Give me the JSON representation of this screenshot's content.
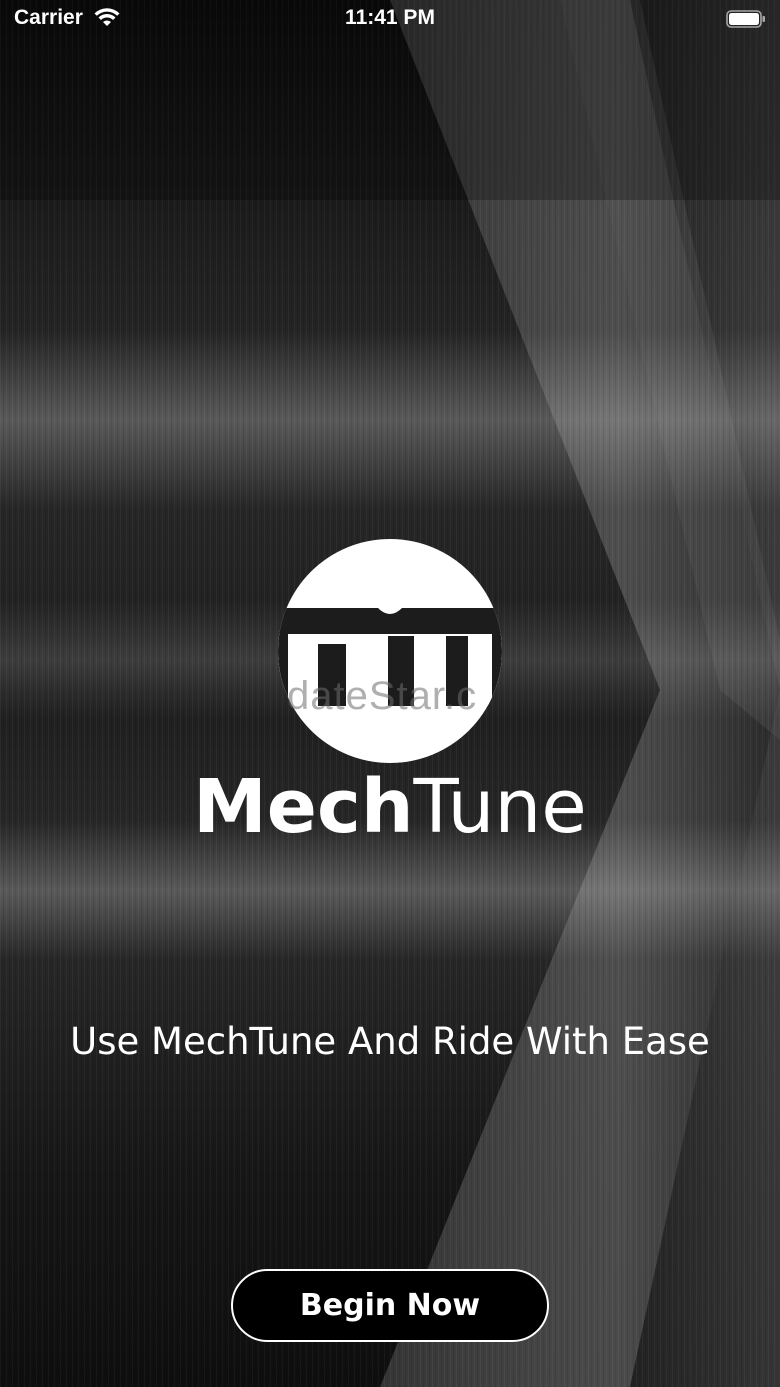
{
  "status_bar": {
    "carrier": "Carrier",
    "time": "11:41 PM",
    "icons": [
      "wifi-icon",
      "battery-icon"
    ]
  },
  "logo": {
    "icon": "mechtune-logo-icon",
    "watermark_text": "dateStar.c"
  },
  "brand": {
    "name_bold": "Mech",
    "name_light": "Tune"
  },
  "tagline": "Use MechTune And Ride With Ease",
  "begin_button": {
    "label": "Begin Now"
  },
  "colors": {
    "background": "#141414",
    "text": "#ffffff",
    "button_fill": "#000000",
    "button_border": "#ffffff"
  }
}
